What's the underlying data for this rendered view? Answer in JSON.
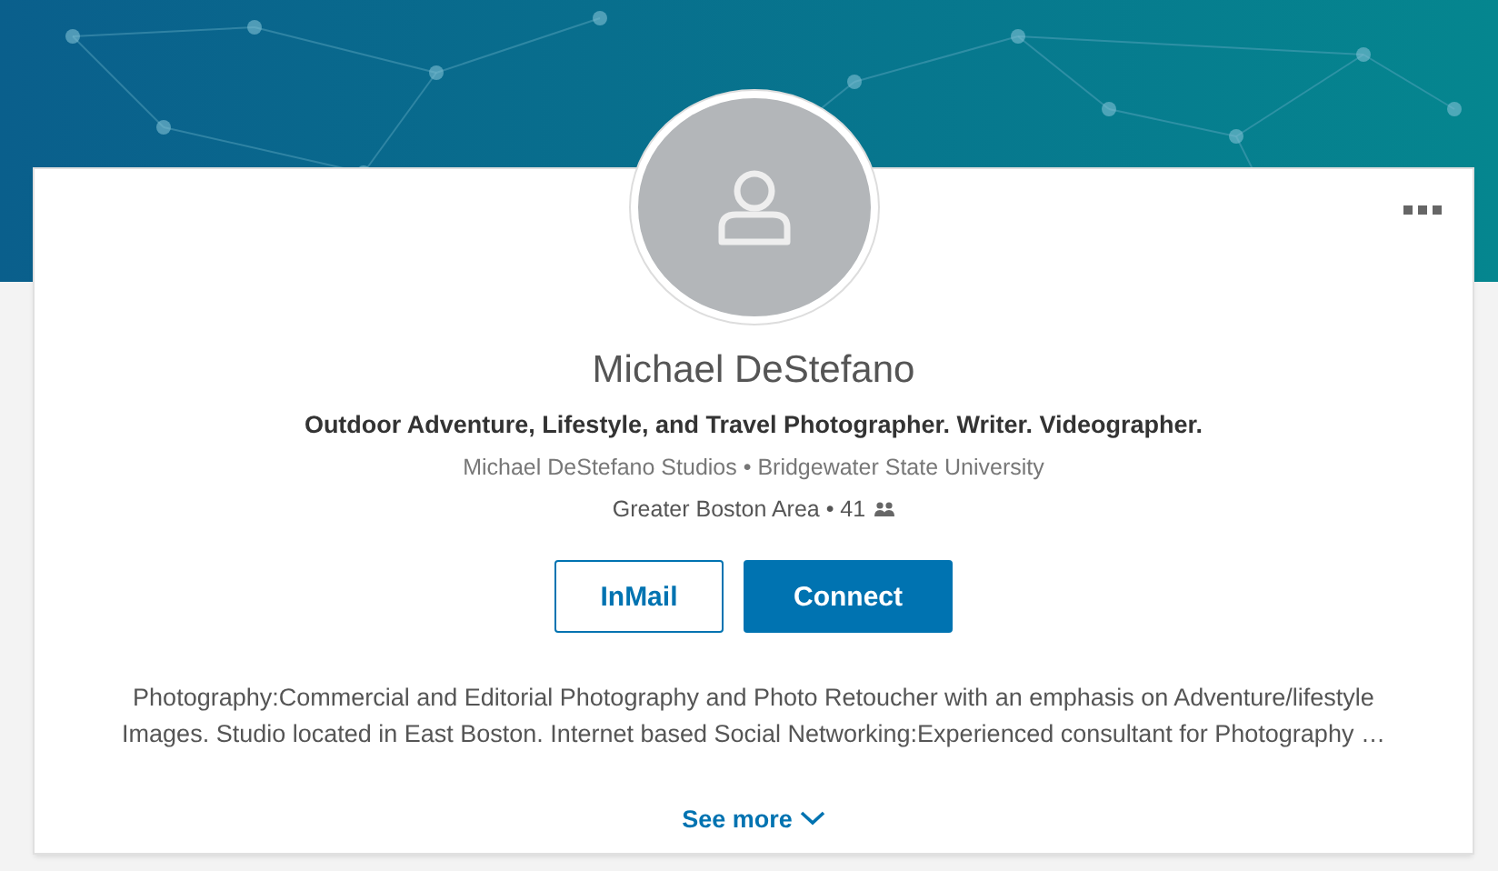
{
  "profile": {
    "name": "Michael DeStefano",
    "headline": "Outdoor Adventure, Lifestyle, and Travel Photographer. Writer. Videographer.",
    "affiliations": "Michael DeStefano Studios • Bridgewater State University",
    "location_connections": "Greater Boston Area • 41"
  },
  "buttons": [
    {
      "label": "InMail",
      "kind": "outline"
    },
    {
      "label": "Connect",
      "kind": "primary"
    }
  ],
  "summary": "Photography:Commercial and Editorial Photography and Photo Retoucher with an emphasis on Adventure/lifestyle Images. Studio located in East Boston. Internet based Social Networking:Experienced consultant for Photography …",
  "see_more": "See more"
}
